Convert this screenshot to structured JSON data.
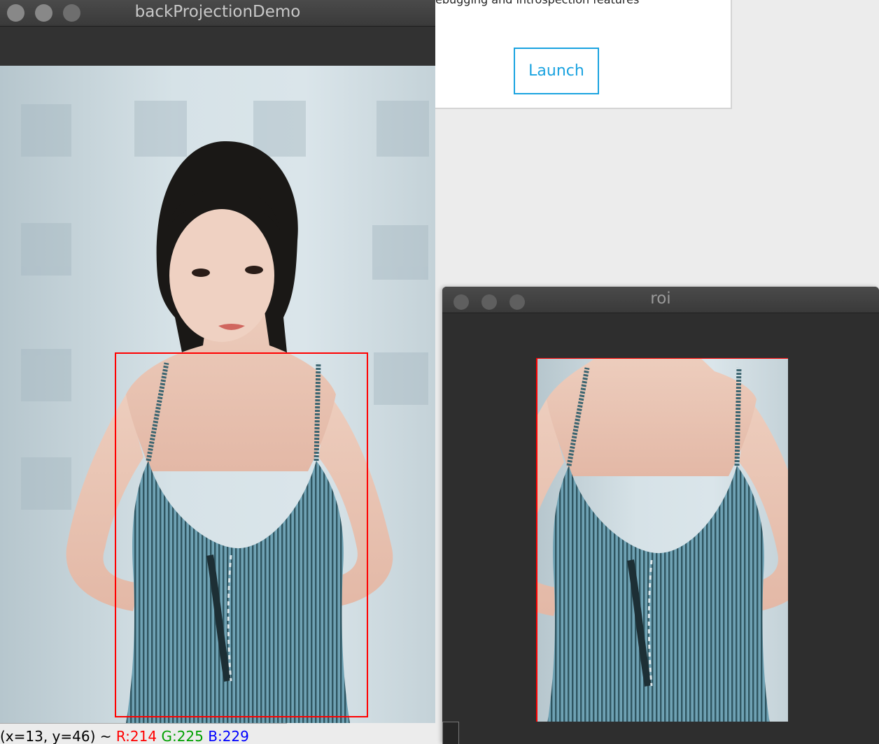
{
  "background_app": {
    "cut_text": "ebugging and introspection features",
    "launch_label": "Launch",
    "accent": "#1aa3e0"
  },
  "main_window": {
    "title": "backProjectionDemo",
    "status": {
      "coords": "(x=13, y=46) ~",
      "r": "R:214",
      "g": "G:225",
      "b": "B:229",
      "r_color": "#ff0000",
      "g_color": "#00a000",
      "b_color": "#0000ff"
    },
    "selection_color": "#ff0000"
  },
  "roi_window": {
    "title": "roi"
  }
}
